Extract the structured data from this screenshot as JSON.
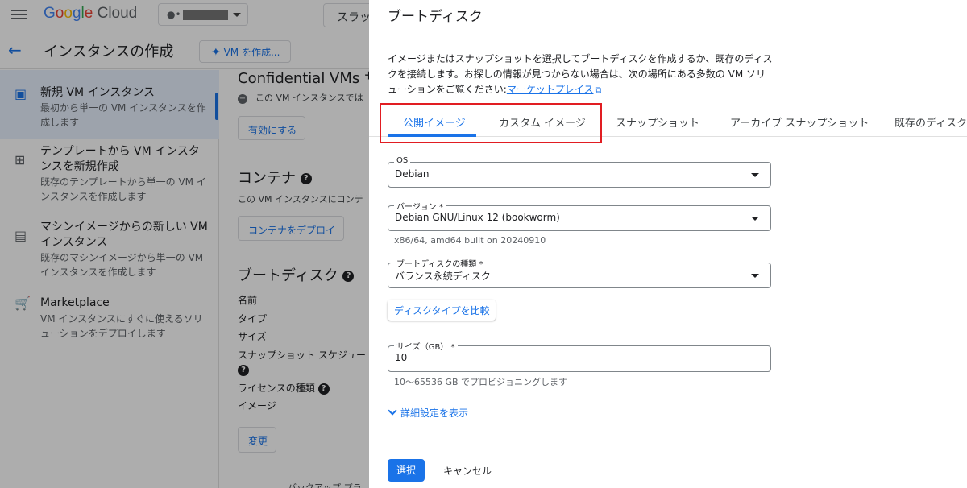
{
  "brand": {
    "name_parts": [
      {
        "text": "G",
        "color": "#4285F4"
      },
      {
        "text": "o",
        "color": "#EA4335"
      },
      {
        "text": "o",
        "color": "#FBBC05"
      },
      {
        "text": "g",
        "color": "#4285F4"
      },
      {
        "text": "l",
        "color": "#34A853"
      },
      {
        "text": "e",
        "color": "#EA4335"
      },
      {
        "text": " Cloud",
        "color": "#5f6368"
      }
    ]
  },
  "topbar": {
    "search_label": "スラッ"
  },
  "titlebar": {
    "title": "インスタンスの作成",
    "create_vm_label": "VM を作成..."
  },
  "sidebar": {
    "items": [
      {
        "title": "新規 VM インスタンス",
        "subtitle": "最初から単一の VM インスタンスを作成します",
        "icon": "add-box-icon",
        "active": true
      },
      {
        "title": "テンプレートから VM インスタンスを新規作成",
        "subtitle": "既存のテンプレートから単一の VM インスタンスを作成します",
        "icon": "template-icon",
        "active": false
      },
      {
        "title": "マシンイメージからの新しい VM インスタンス",
        "subtitle": "既存のマシンイメージから単一の VM インスタンスを作成します",
        "icon": "machine-image-icon",
        "active": false
      },
      {
        "title": "Marketplace",
        "subtitle": "VM インスタンスにすぐに使えるソリューションをデプロイします",
        "icon": "cart-icon",
        "active": false
      }
    ]
  },
  "main": {
    "confidential": {
      "title": "Confidential VMs サ",
      "text": "この VM インスタンスでは",
      "button": "有効にする"
    },
    "container": {
      "title": "コンテナ",
      "text": "この VM インスタンスにコンテ",
      "button": "コンテナをデプロイ"
    },
    "bootdisk": {
      "title": "ブートディスク",
      "props": [
        "名前",
        "タイプ",
        "サイズ",
        "スナップショット スケジュー",
        "ライセンスの種類",
        "イメージ"
      ],
      "change_button": "変更"
    },
    "backup_text": "バックアップ プラ"
  },
  "dialog": {
    "title": "ブートディスク",
    "description": "イメージまたはスナップショットを選択してブートディスクを作成するか、既存のディスクを接続します。お探しの情報が見つからない場合は、次の場所にある多数の VM ソリューションをご覧ください:",
    "marketplace_link": "マーケットプレイス",
    "tabs": [
      "公開イメージ",
      "カスタム イメージ",
      "スナップショット",
      "アーカイブ スナップショット",
      "既存のディスク"
    ],
    "active_tab": "公開イメージ",
    "os": {
      "label": "OS",
      "value": "Debian"
    },
    "version": {
      "label": "バージョン *",
      "value": "Debian GNU/Linux 12 (bookworm)",
      "hint": "x86/64, amd64 built on 20240910"
    },
    "disk_type": {
      "label": "ブートディスクの種類 *",
      "value": "バランス永続ディスク"
    },
    "compare_button": "ディスクタイプを比較",
    "size": {
      "label": "サイズ（GB） *",
      "value": "10",
      "hint": "10〜65536 GB でプロビジョニングします"
    },
    "advanced_link": "詳細設定を表示",
    "select_button": "選択",
    "cancel_button": "キャンセル"
  },
  "colors": {
    "accent": "#1a73e8",
    "highlight": "#e11d22"
  }
}
